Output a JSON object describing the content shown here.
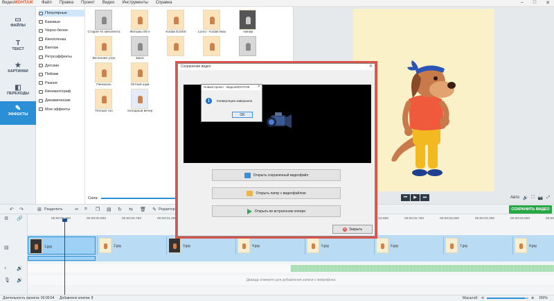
{
  "app": {
    "name_prefix": "Видео",
    "name_suffix": "МОНТАЖ"
  },
  "menu": [
    "Файл",
    "Правка",
    "Проект",
    "Видео",
    "Инструменты",
    "Справка"
  ],
  "window_controls": [
    "–",
    "□",
    "✕"
  ],
  "left_tabs": [
    {
      "label": "ФАЙЛЫ",
      "icon": "folder-icon"
    },
    {
      "label": "ТЕКСТ",
      "icon": "text-icon"
    },
    {
      "label": "КАРТИНКИ",
      "icon": "star-icon"
    },
    {
      "label": "ПЕРЕХОДЫ",
      "icon": "transitions-icon"
    },
    {
      "label": "ЭФФЕКТЫ",
      "icon": "effects-icon"
    }
  ],
  "filters": [
    "Популярные",
    "Базовые",
    "Черно-белое",
    "Кинопленка",
    "Винтаж",
    "Ретроэффекты",
    "Детские",
    "Пейзаж",
    "Разное",
    "Кинематограф",
    "Динамические",
    "Мои эффекты"
  ],
  "thumbnails": [
    {
      "label": "Старая чб кинолента",
      "tone": "gray"
    },
    {
      "label": "Фильмы 80-х",
      "tone": "warm"
    },
    {
      "label": "Kodak E100S",
      "tone": "warm"
    },
    {
      "label": "Lomo - Kodak Max",
      "tone": "warm"
    },
    {
      "label": "Ампир",
      "tone": "dark"
    },
    {
      "label": "Весенние утро",
      "tone": "warm"
    },
    {
      "label": "Закат",
      "tone": "gray"
    },
    {
      "label": "",
      "tone": "warm"
    },
    {
      "label": "",
      "tone": "warm"
    },
    {
      "label": "",
      "tone": "gray"
    },
    {
      "label": "Пинаколь",
      "tone": "warm"
    },
    {
      "label": "Летний шум",
      "tone": "warm"
    },
    {
      "label": "Теплый тон",
      "tone": "warm"
    },
    {
      "label": "Холодный вечер",
      "tone": "cool"
    }
  ],
  "slider": {
    "label": "Сила:",
    "value": 0.92
  },
  "playback": [
    "⏮",
    "▶",
    "⏭"
  ],
  "aspect": {
    "label": "Авто",
    "icons": [
      "🔊",
      "⛶",
      "📷",
      "⤢"
    ]
  },
  "toolbar": {
    "split_label": "Разделить",
    "editor_label": "Редактор",
    "save_label": "СОХРАНИТЬ ВИДЕО"
  },
  "ruler": [
    "00:00:00.000",
    "00:00:00.500",
    "00:00:00.750",
    "00:00:01.000",
    "00:00:01.250",
    "00:00:01.500",
    "00:00:01.750",
    "00:00:02.000",
    "00:00:02.250",
    "00:00:02.500",
    "00:00:02.750",
    "00:00:03.000",
    "00:00:03.250",
    "00:00:03.500",
    "00:00:03.750"
  ],
  "clips": [
    {
      "name": "1.jpg",
      "dark": true,
      "selected": true
    },
    {
      "name": "2.jpg",
      "dark": false,
      "selected": false
    },
    {
      "name": "3.jpg",
      "dark": true,
      "selected": false
    },
    {
      "name": "4.jpg",
      "dark": false,
      "selected": false
    },
    {
      "name": "5.jpg",
      "dark": false,
      "selected": false
    },
    {
      "name": "6.jpg",
      "dark": false,
      "selected": false
    },
    {
      "name": "7.jpg",
      "dark": false,
      "selected": false
    },
    {
      "name": "8.jpg",
      "dark": false,
      "selected": false
    }
  ],
  "mic_hint": "Дважды кликните для добавления записи с микрофона",
  "status": {
    "duration": "Длительность проекта: 00:00:04",
    "clips": "Добавлено клипов: 8",
    "zoom_label": "Масштаб:",
    "zoom_value": "200%",
    "zoom_level": 0.92
  },
  "save_dialog": {
    "title": "Сохранение видео",
    "buttons": [
      {
        "label": "Открыть сохраненный видеофайл",
        "icon": "film-folder-icon",
        "color": "#3b8ed8"
      },
      {
        "label": "Открыть папку с видеофайлом",
        "icon": "folder-open-icon",
        "color": "#e8b64a"
      },
      {
        "label": "Открыть во встроенном плеере",
        "icon": "play-green-icon",
        "color": "#34a853"
      }
    ],
    "close_label": "Закрыть"
  },
  "message_box": {
    "title": "Новый проект - ВидеоМОНТАЖ",
    "text": "Конвертация завершена",
    "ok": "OK"
  },
  "colors": {
    "accent": "#2b8fd6",
    "save": "#28a745",
    "highlight": "#d9534f"
  }
}
